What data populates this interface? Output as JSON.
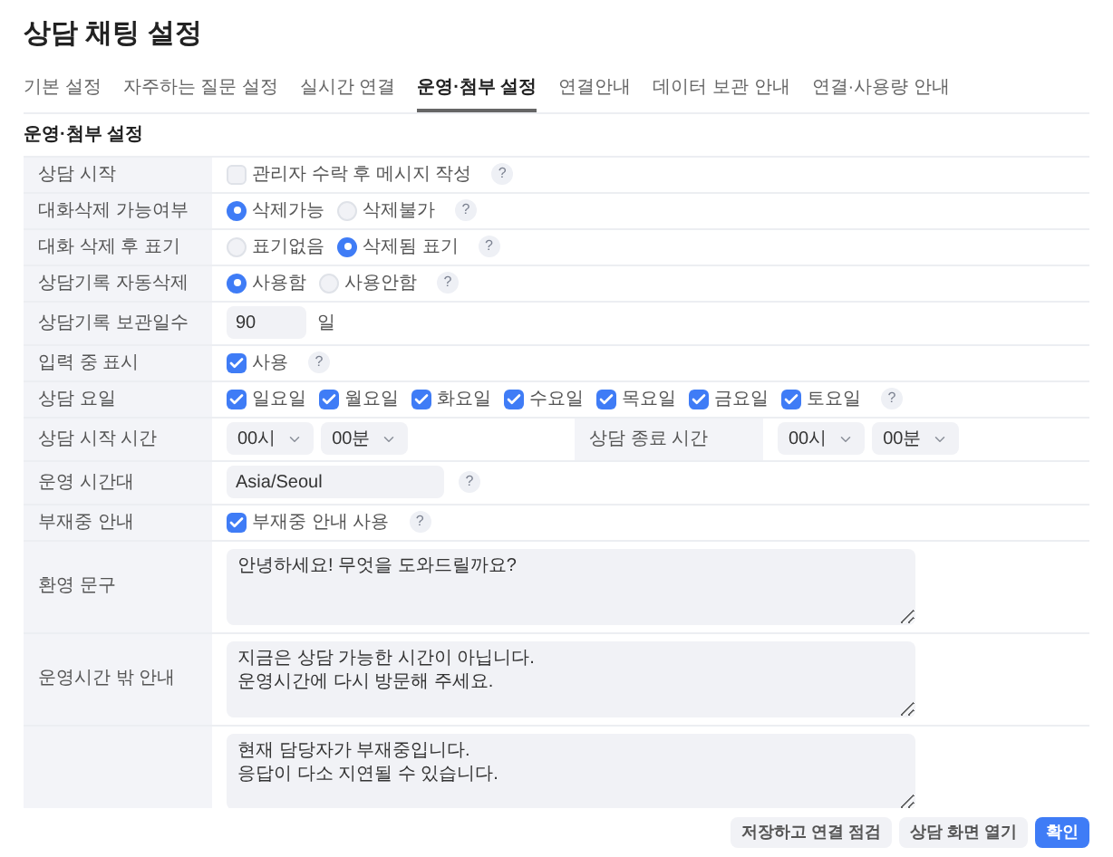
{
  "title": "상담 채팅 설정",
  "tabs": [
    {
      "label": "기본 설정",
      "selected": false
    },
    {
      "label": "자주하는 질문 설정",
      "selected": false
    },
    {
      "label": "실시간 연결",
      "selected": false
    },
    {
      "label": "운영·첨부 설정",
      "selected": true
    },
    {
      "label": "연결안내",
      "selected": false
    },
    {
      "label": "데이터 보관 안내",
      "selected": false
    },
    {
      "label": "연결·사용량 안내",
      "selected": false
    }
  ],
  "section_title": "운영·첨부 설정",
  "rows": [
    {
      "kind": "checkbox",
      "label": "상담 시작",
      "options": [
        {
          "label": "관리자 수락 후 메시지 작성",
          "checked": false
        }
      ],
      "help": "?"
    },
    {
      "kind": "radio",
      "label": "대화삭제 가능여부",
      "options": [
        {
          "label": "삭제가능",
          "selected": true
        },
        {
          "label": "삭제불가",
          "selected": false
        }
      ],
      "help": "?"
    },
    {
      "kind": "radio",
      "label": "대화 삭제 후 표기",
      "options": [
        {
          "label": "표기없음",
          "selected": false
        },
        {
          "label": "삭제됨 표기",
          "selected": true
        }
      ],
      "help": "?"
    },
    {
      "kind": "radio",
      "label": "상담기록 자동삭제",
      "options": [
        {
          "label": "사용함",
          "selected": true
        },
        {
          "label": "사용안함",
          "selected": false
        }
      ],
      "help": "?"
    },
    {
      "kind": "number",
      "label": "상담기록 보관일수",
      "value": "90",
      "unit": "일"
    },
    {
      "kind": "checkbox",
      "label": "입력 중 표시",
      "options": [
        {
          "label": "사용",
          "checked": true
        }
      ],
      "help": "?"
    },
    {
      "kind": "checkbox",
      "label": "상담 요일",
      "options": [
        {
          "label": "일요일",
          "checked": true
        },
        {
          "label": "월요일",
          "checked": true
        },
        {
          "label": "화요일",
          "checked": true
        },
        {
          "label": "수요일",
          "checked": true
        },
        {
          "label": "목요일",
          "checked": true
        },
        {
          "label": "금요일",
          "checked": true
        },
        {
          "label": "토요일",
          "checked": true
        }
      ],
      "help": "?"
    },
    {
      "kind": "time",
      "label": "상담 시작 시간",
      "selects": [
        "00시",
        "00분"
      ],
      "label_2": "상담 종료 시간",
      "selects_2": [
        "00시",
        "00분"
      ]
    },
    {
      "kind": "text",
      "label": "운영 시간대",
      "value": "Asia/Seoul",
      "help": "?"
    },
    {
      "kind": "checkbox",
      "label": "부재중 안내",
      "options": [
        {
          "label": "부재중 안내 사용",
          "checked": true
        }
      ],
      "help": "?"
    },
    {
      "kind": "textarea",
      "label": "환영 문구",
      "value": "안녕하세요! 무엇을 도와드릴까요?"
    },
    {
      "kind": "textarea",
      "label": "운영시간 밖 안내",
      "value": "지금은 상담 가능한 시간이 아닙니다.\n운영시간에 다시 방문해 주세요."
    },
    {
      "kind": "textarea",
      "value": "현재 담당자가 부재중입니다.\n응답이 다소 지연될 수 있습니다."
    }
  ],
  "footer_buttons": [
    {
      "label": "저장하고 연결 점검",
      "primary": false
    },
    {
      "label": "상담 화면 열기",
      "primary": false
    },
    {
      "label": "확인",
      "primary": true
    }
  ]
}
